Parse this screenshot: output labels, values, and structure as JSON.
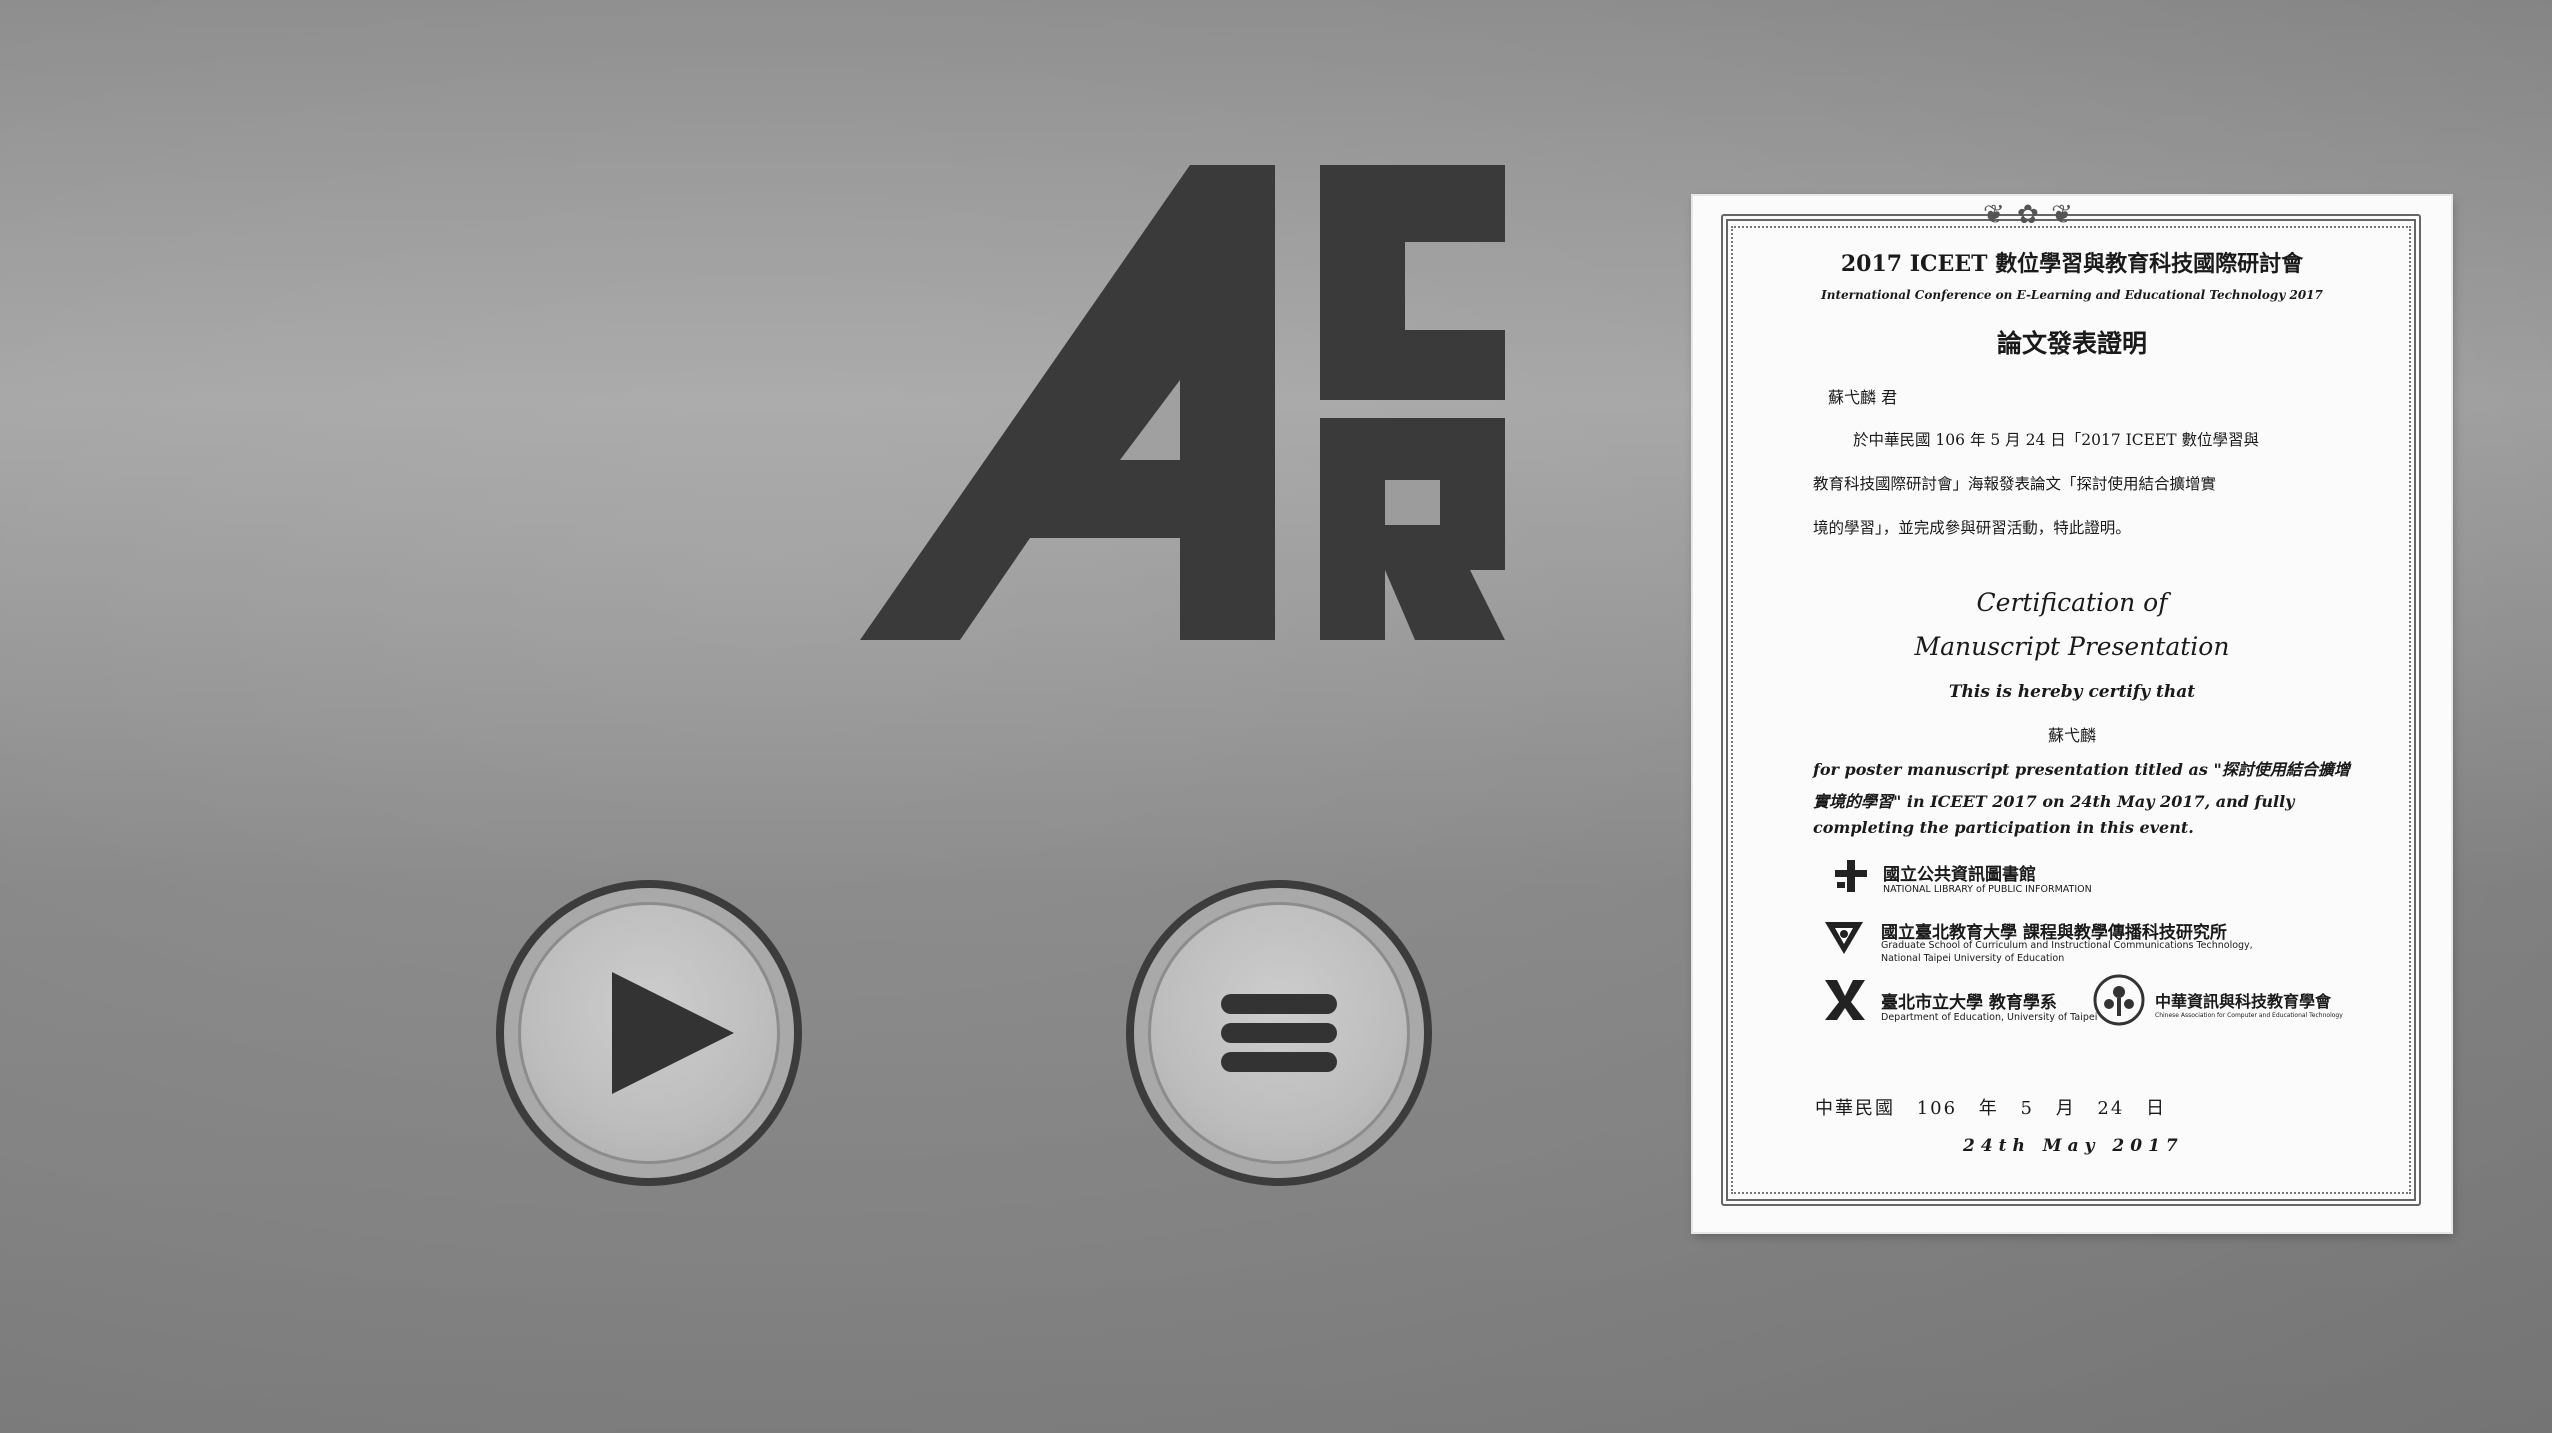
{
  "app": {
    "logo_letters": [
      "A",
      "C",
      "R"
    ]
  },
  "controls": {
    "play_icon": "play-icon",
    "menu_icon": "menu-icon"
  },
  "certificate": {
    "title_zh": "2017 ICEET 數位學習與教育科技國際研討會",
    "title_en": "International Conference on E-Learning and Educational Technology 2017",
    "heading_zh": "論文發表證明",
    "recipient_line_zh": "蘇弋麟 君",
    "body_zh": [
      "於中華民國 106 年 5 月 24 日「2017 ICEET 數位學習與",
      "教育科技國際研討會」海報發表論文「探討使用結合擴增實",
      "境的學習」，並完成參與研習活動，特此證明。"
    ],
    "heading_en_1": "Certification of",
    "heading_en_2": "Manuscript Presentation",
    "certify_text": "This is hereby certify that",
    "recipient_en": "蘇弋麟",
    "body_en": [
      "for poster manuscript presentation titled as \"探討使用結合擴增",
      "實境的學習\" in ICEET 2017 on 24th May 2017, and fully",
      "completing the participation in this event."
    ],
    "organizers": [
      {
        "name": "國立公共資訊圖書館",
        "sub": "NATIONAL LIBRARY of PUBLIC INFORMATION"
      },
      {
        "name": "國立臺北教育大學 課程與教學傳播科技研究所",
        "sub": "Graduate School of Curriculum and Instructional Communications Technology,",
        "sub2": "National Taipei University of Education"
      },
      {
        "name": "臺北市立大學 教育學系",
        "sub": "Department of Education, University of Taipei"
      },
      {
        "name": "中華資訊與科技教育學會",
        "sub": "Chinese Association for Computer and Educational Technology"
      }
    ],
    "date_zh": "中華民國 106 年 5 月 24 日",
    "date_en": "24th May 2017"
  }
}
